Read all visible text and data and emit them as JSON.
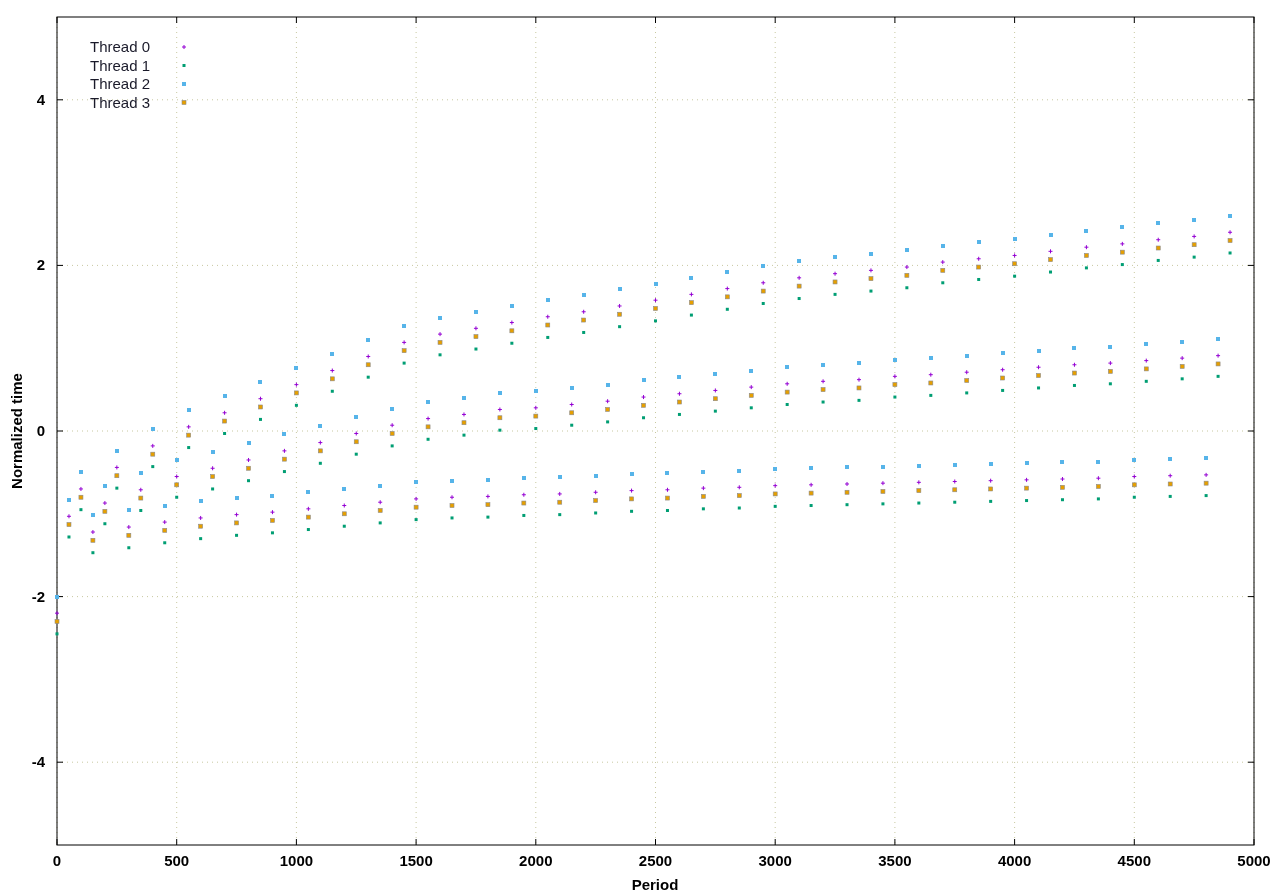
{
  "chart_data": {
    "type": "scatter",
    "grid": true,
    "legend": true,
    "xlabel": "Period",
    "ylabel": "Normalized time",
    "xlim": [
      0,
      5000
    ],
    "ylim": [
      -5,
      5
    ],
    "xticks": [
      0,
      500,
      1000,
      1500,
      2000,
      2500,
      3000,
      3500,
      4000,
      4500,
      5000
    ],
    "yticks": [
      -4,
      -2,
      0,
      2,
      4
    ],
    "x": [
      0,
      50,
      100,
      150,
      200,
      250,
      300,
      350,
      400,
      450,
      500,
      550,
      600,
      650,
      700,
      750,
      800,
      850,
      900,
      950,
      1000,
      1050,
      1100,
      1150,
      1200,
      1250,
      1300,
      1350,
      1400,
      1450,
      1500,
      1550,
      1600,
      1650,
      1700,
      1750,
      1800,
      1850,
      1900,
      1950,
      2000,
      2050,
      2100,
      2150,
      2200,
      2250,
      2300,
      2350,
      2400,
      2450,
      2500,
      2550,
      2600,
      2650,
      2700,
      2750,
      2800,
      2850,
      2900,
      2950,
      3000,
      3050,
      3100,
      3150,
      3200,
      3250,
      3300,
      3350,
      3400,
      3450,
      3500,
      3550,
      3600,
      3650,
      3700,
      3750,
      3800,
      3850,
      3900,
      3950,
      4000,
      4050,
      4100,
      4150,
      4200,
      4250,
      4300,
      4350,
      4400,
      4450,
      4500,
      4550,
      4600,
      4650,
      4700,
      4750,
      4800,
      4850,
      4900
    ],
    "series": [
      {
        "name": "Thread 0",
        "color": "#9400d3",
        "values": [
          -2.2,
          -1.03,
          -0.7,
          -1.22,
          -0.87,
          -0.44,
          -1.16,
          -0.71,
          -0.18,
          -1.1,
          -0.55,
          0.05,
          -1.05,
          -0.45,
          0.22,
          -1.01,
          -0.35,
          0.39,
          -0.98,
          -0.24,
          0.56,
          -0.94,
          -0.14,
          0.73,
          -0.9,
          -0.03,
          0.9,
          -0.86,
          0.07,
          1.07,
          -0.82,
          0.15,
          1.17,
          -0.8,
          0.2,
          1.24,
          -0.79,
          0.26,
          1.31,
          -0.77,
          0.28,
          1.38,
          -0.76,
          0.32,
          1.44,
          -0.74,
          0.36,
          1.51,
          -0.72,
          0.41,
          1.58,
          -0.71,
          0.45,
          1.65,
          -0.69,
          0.49,
          1.72,
          -0.68,
          0.53,
          1.79,
          -0.66,
          0.57,
          1.85,
          -0.65,
          0.6,
          1.9,
          -0.64,
          0.62,
          1.94,
          -0.63,
          0.66,
          1.98,
          -0.62,
          0.68,
          2.04,
          -0.61,
          0.71,
          2.08,
          -0.6,
          0.74,
          2.12,
          -0.59,
          0.77,
          2.17,
          -0.58,
          0.8,
          2.22,
          -0.57,
          0.82,
          2.26,
          -0.55,
          0.85,
          2.31,
          -0.54,
          0.88,
          2.35,
          -0.53,
          0.91,
          2.4
        ]
      },
      {
        "name": "Thread 1",
        "color": "#009e73",
        "values": [
          -2.45,
          -1.28,
          -0.95,
          -1.47,
          -1.12,
          -0.69,
          -1.41,
          -0.96,
          -0.43,
          -1.35,
          -0.8,
          -0.2,
          -1.3,
          -0.7,
          -0.03,
          -1.26,
          -0.6,
          0.14,
          -1.23,
          -0.49,
          0.31,
          -1.19,
          -0.39,
          0.48,
          -1.15,
          -0.28,
          0.65,
          -1.11,
          -0.18,
          0.82,
          -1.07,
          -0.1,
          0.92,
          -1.05,
          -0.05,
          0.99,
          -1.04,
          0.01,
          1.06,
          -1.02,
          0.03,
          1.13,
          -1.01,
          0.07,
          1.19,
          -0.99,
          0.11,
          1.26,
          -0.97,
          0.16,
          1.33,
          -0.96,
          0.2,
          1.4,
          -0.94,
          0.24,
          1.47,
          -0.93,
          0.28,
          1.54,
          -0.91,
          0.32,
          1.6,
          -0.9,
          0.35,
          1.65,
          -0.89,
          0.37,
          1.69,
          -0.88,
          0.41,
          1.73,
          -0.87,
          0.43,
          1.79,
          -0.86,
          0.46,
          1.83,
          -0.85,
          0.49,
          1.87,
          -0.84,
          0.52,
          1.92,
          -0.83,
          0.55,
          1.97,
          -0.82,
          0.57,
          2.01,
          -0.8,
          0.6,
          2.06,
          -0.79,
          0.63,
          2.1,
          -0.78,
          0.66,
          2.15
        ]
      },
      {
        "name": "Thread 2",
        "color": "#56b4e9",
        "values": [
          -2.0,
          -0.83,
          -0.5,
          -1.02,
          -0.67,
          -0.24,
          -0.96,
          -0.51,
          0.02,
          -0.9,
          -0.35,
          0.25,
          -0.85,
          -0.25,
          0.42,
          -0.81,
          -0.15,
          0.59,
          -0.78,
          -0.04,
          0.76,
          -0.74,
          0.06,
          0.93,
          -0.7,
          0.17,
          1.1,
          -0.66,
          0.27,
          1.27,
          -0.62,
          0.35,
          1.37,
          -0.6,
          0.4,
          1.44,
          -0.59,
          0.46,
          1.51,
          -0.57,
          0.48,
          1.58,
          -0.56,
          0.52,
          1.64,
          -0.54,
          0.56,
          1.71,
          -0.52,
          0.61,
          1.78,
          -0.51,
          0.65,
          1.85,
          -0.49,
          0.69,
          1.92,
          -0.48,
          0.73,
          1.99,
          -0.46,
          0.77,
          2.05,
          -0.45,
          0.8,
          2.1,
          -0.44,
          0.82,
          2.14,
          -0.43,
          0.86,
          2.18,
          -0.42,
          0.88,
          2.24,
          -0.41,
          0.91,
          2.28,
          -0.4,
          0.94,
          2.32,
          -0.39,
          0.97,
          2.37,
          -0.38,
          1.0,
          2.42,
          -0.37,
          1.02,
          2.46,
          -0.35,
          1.05,
          2.51,
          -0.34,
          1.08,
          2.55,
          -0.33,
          1.11,
          2.6
        ]
      },
      {
        "name": "Thread 3",
        "color": "#e69f00",
        "values": [
          -2.3,
          -1.13,
          -0.8,
          -1.32,
          -0.97,
          -0.54,
          -1.26,
          -0.81,
          -0.28,
          -1.2,
          -0.65,
          -0.05,
          -1.15,
          -0.55,
          0.12,
          -1.11,
          -0.45,
          0.29,
          -1.08,
          -0.34,
          0.46,
          -1.04,
          -0.24,
          0.63,
          -1.0,
          -0.13,
          0.8,
          -0.96,
          -0.03,
          0.97,
          -0.92,
          0.05,
          1.07,
          -0.9,
          0.1,
          1.14,
          -0.89,
          0.16,
          1.21,
          -0.87,
          0.18,
          1.28,
          -0.86,
          0.22,
          1.34,
          -0.84,
          0.26,
          1.41,
          -0.82,
          0.31,
          1.48,
          -0.81,
          0.35,
          1.55,
          -0.79,
          0.39,
          1.62,
          -0.78,
          0.43,
          1.69,
          -0.76,
          0.47,
          1.75,
          -0.75,
          0.5,
          1.8,
          -0.74,
          0.52,
          1.84,
          -0.73,
          0.56,
          1.88,
          -0.72,
          0.58,
          1.94,
          -0.71,
          0.61,
          1.98,
          -0.7,
          0.64,
          2.02,
          -0.69,
          0.67,
          2.07,
          -0.68,
          0.7,
          2.12,
          -0.67,
          0.72,
          2.16,
          -0.65,
          0.75,
          2.21,
          -0.64,
          0.78,
          2.25,
          -0.63,
          0.81,
          2.3
        ]
      }
    ]
  }
}
